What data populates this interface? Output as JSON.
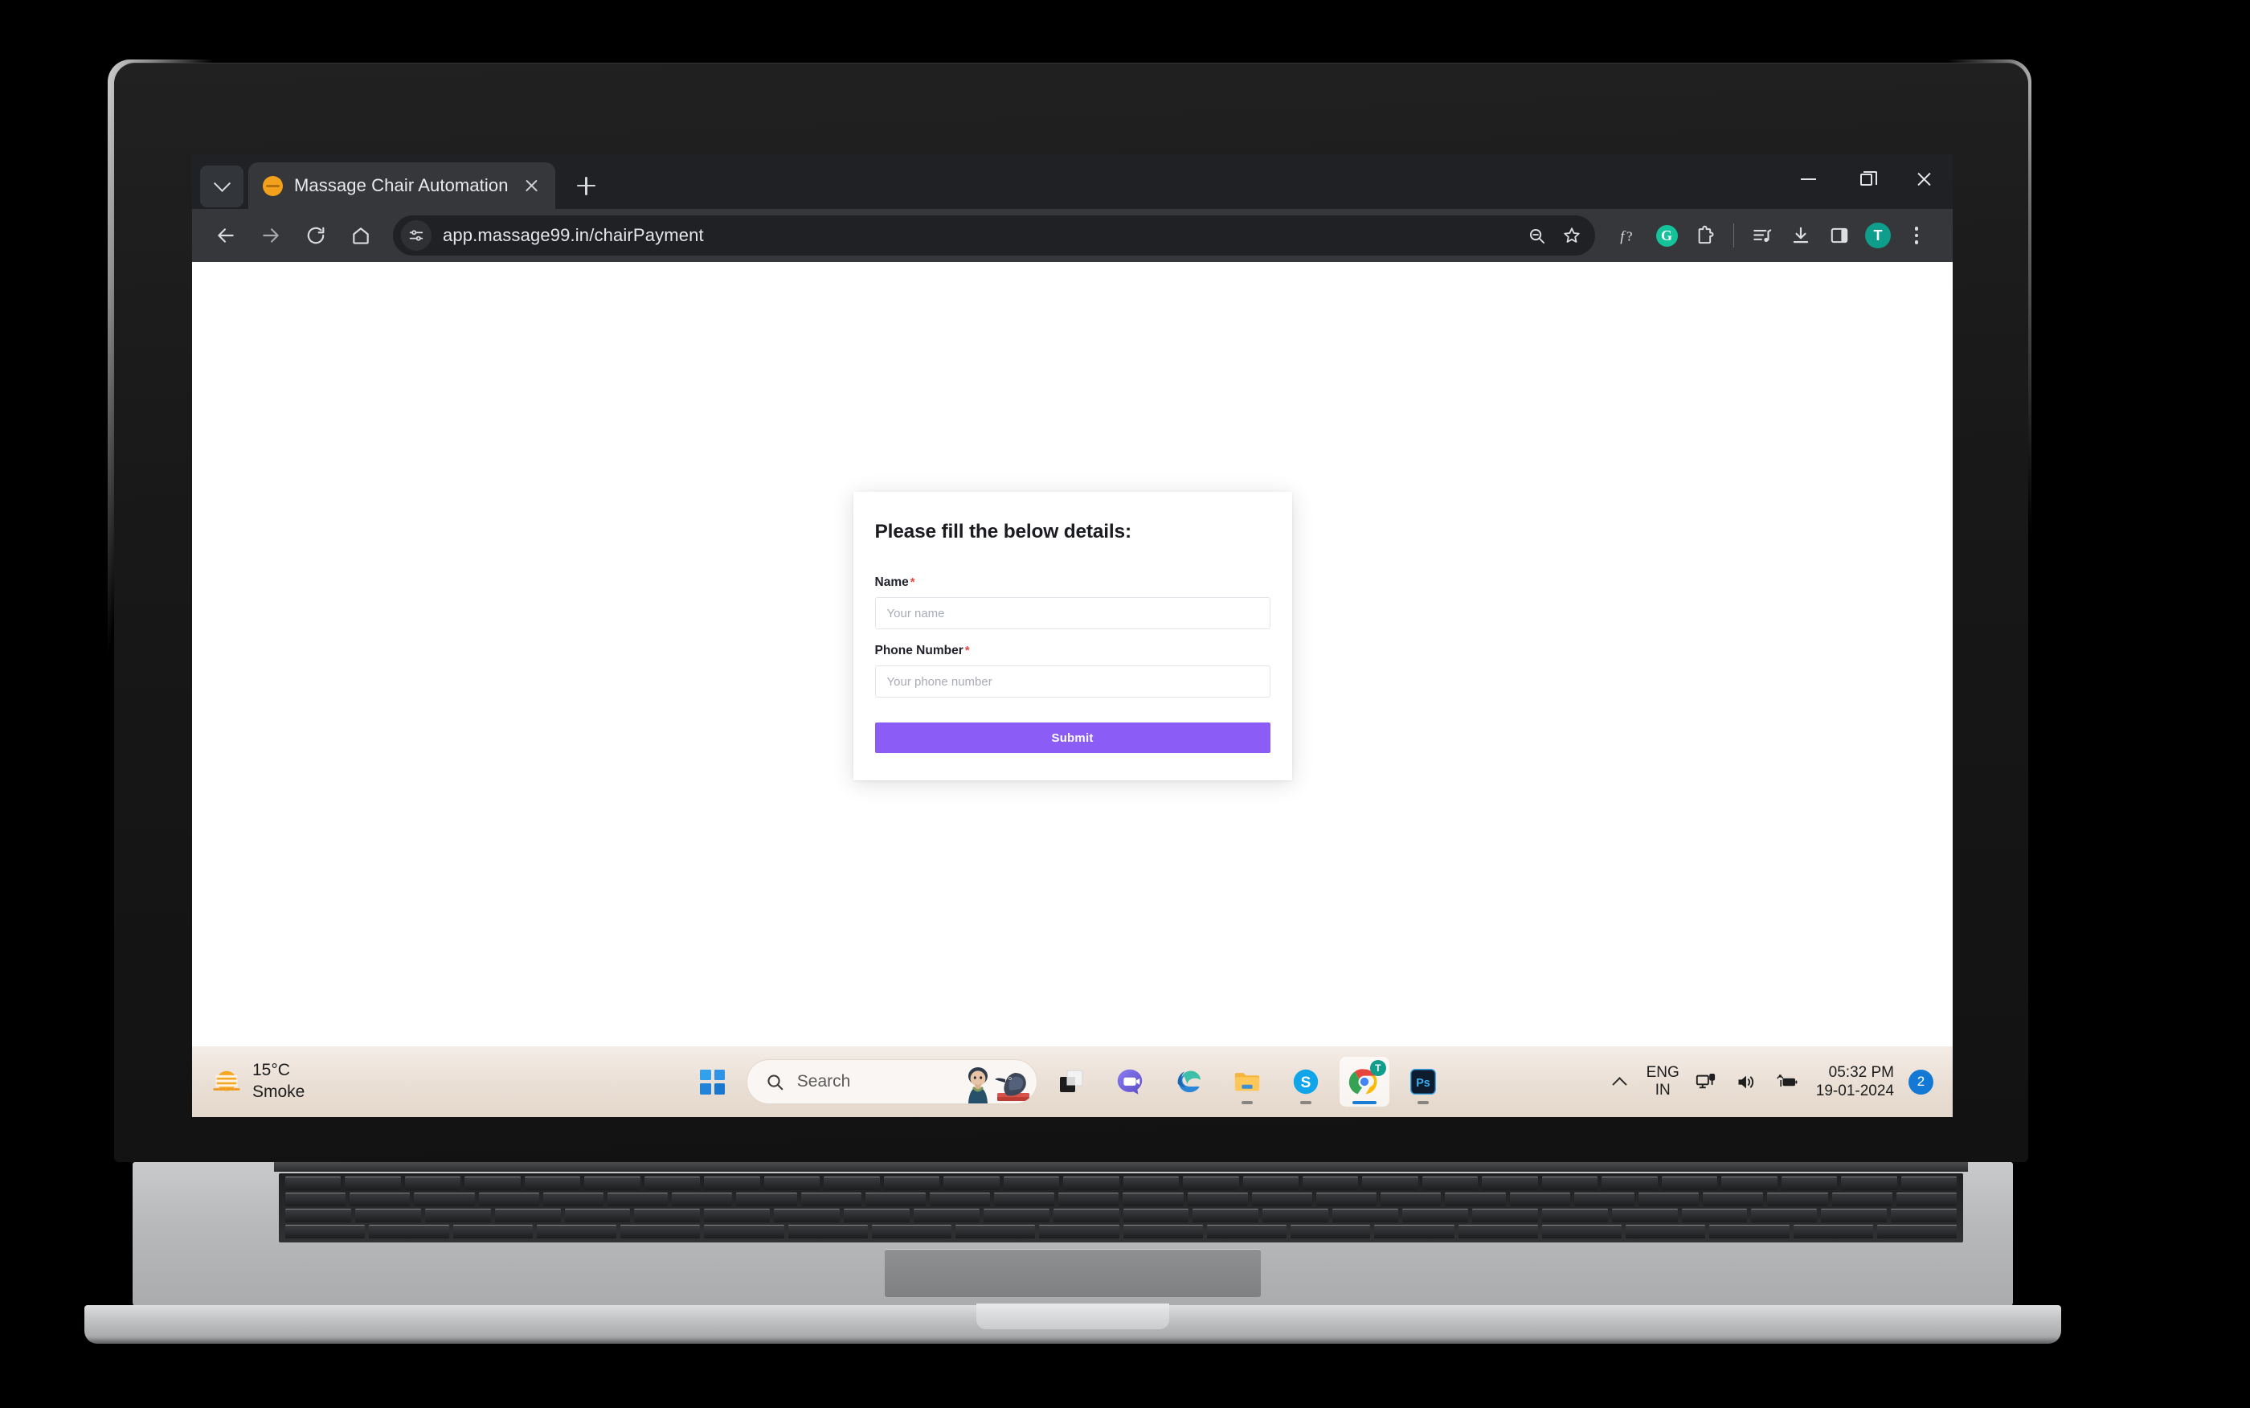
{
  "browser": {
    "tab": {
      "title": "Massage Chair Automation",
      "favicon_name": "orange-circle-favicon"
    },
    "new_tab_label": "+",
    "omnibox": {
      "url": "app.massage99.in/chairPayment"
    },
    "toolbar_icons": [
      "back-icon",
      "forward-icon",
      "reload-icon",
      "home-icon",
      "site-settings-icon",
      "zoom-out-icon",
      "bookmark-star-icon",
      "font-extension-icon",
      "grammarly-extension-icon",
      "extensions-puzzle-icon",
      "reading-list-icon",
      "downloads-icon",
      "side-panel-icon",
      "profile-avatar",
      "three-dot-menu-icon"
    ],
    "grammarly_letter": "G",
    "profile_initial": "T",
    "profile_color": "#0f9d8c",
    "window_controls": {
      "minimize": "minimize-icon",
      "maximize": "restore-icon",
      "close": "close-icon"
    }
  },
  "page": {
    "heading": "Please fill the below details:",
    "required_marker": "*",
    "fields": [
      {
        "label": "Name",
        "placeholder": "Your name",
        "value": "",
        "required": true
      },
      {
        "label": "Phone Number",
        "placeholder": "Your phone number",
        "value": "",
        "required": true
      }
    ],
    "submit_label": "Submit",
    "accent_color": "#8b5cf6"
  },
  "taskbar": {
    "weather": {
      "temperature": "15°C",
      "condition": "Smoke",
      "icon_name": "haze-sun-icon"
    },
    "start_label": "start-button",
    "search": {
      "placeholder": "Search",
      "icon_name": "search-icon"
    },
    "apps": [
      {
        "name": "task-view",
        "label": "Task View",
        "active": false,
        "running": false
      },
      {
        "name": "microsoft-teams",
        "label": "Microsoft Teams",
        "active": false,
        "running": false
      },
      {
        "name": "microsoft-edge",
        "label": "Microsoft Edge",
        "active": false,
        "running": false
      },
      {
        "name": "file-explorer",
        "label": "File Explorer",
        "active": false,
        "running": true
      },
      {
        "name": "skype",
        "label": "Skype",
        "active": false,
        "running": true
      },
      {
        "name": "google-chrome",
        "label": "Google Chrome",
        "active": true,
        "running": true
      },
      {
        "name": "adobe-photoshop",
        "label": "Adobe Photoshop",
        "active": false,
        "running": true
      }
    ],
    "chrome_badge_initial": "T",
    "photoshop_label": "Ps",
    "skype_label": "S",
    "tray": {
      "chevron": "show-hidden-icons",
      "language_primary": "ENG",
      "language_secondary": "IN",
      "network_icon": "ethernet-icon",
      "volume_icon": "volume-icon",
      "battery_icon": "battery-charging-icon",
      "time": "05:32 PM",
      "date": "19-01-2024",
      "notification_count": "2"
    }
  }
}
